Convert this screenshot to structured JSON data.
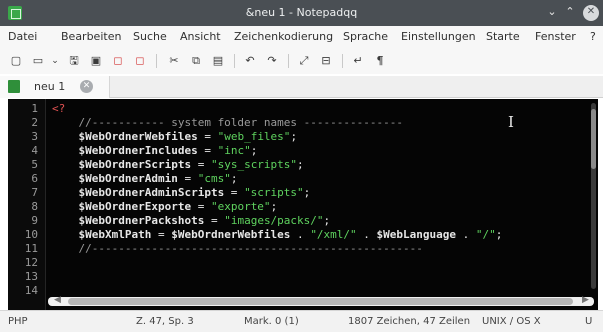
{
  "window": {
    "title": "&neu 1 - Notepadqq",
    "minimize_glyph": "⌄",
    "maximize_glyph": "⌃",
    "close_glyph": "✕"
  },
  "menu": [
    "Datei",
    "Bearbeiten",
    "Suche",
    "Ansicht",
    "Zeichenkodierung",
    "Sprache",
    "Einstellungen",
    "Starte",
    "Fenster",
    "?"
  ],
  "toolbar": {
    "icons": [
      "new-file-icon",
      "open-folder-icon",
      "dropdown-arrow-icon",
      "save-icon",
      "save-all-icon",
      "close-file-icon",
      "close-all-icon",
      "cut-icon",
      "copy-icon",
      "paste-icon",
      "undo-icon",
      "redo-icon",
      "zoom-in-icon",
      "zoom-out-icon",
      "word-wrap-icon",
      "show-all-chars-icon"
    ],
    "glyphs": [
      "▢",
      "▭",
      "⌄",
      "🖫",
      "▣",
      "◻",
      "◻",
      "✂",
      "⧉",
      "▤",
      "↶",
      "↷",
      "⤢",
      "⊟",
      "↵",
      "¶"
    ]
  },
  "tabs": [
    {
      "label": "neu 1",
      "close_glyph": "✕"
    }
  ],
  "editor": {
    "line_numbers": [
      "1",
      "2",
      "3",
      "4",
      "5",
      "6",
      "7",
      "8",
      "9",
      "10",
      "11",
      "12",
      "13",
      "14"
    ],
    "lines": [
      [
        {
          "t": "<?",
          "c": "c-tag"
        }
      ],
      [
        {
          "t": "    //----------- system folder names ---------------",
          "c": "c-comment"
        }
      ],
      [
        {
          "t": "    $WebOrdnerWebfiles",
          "c": "c-var"
        },
        {
          "t": " = ",
          "c": "c-op"
        },
        {
          "t": "\"web_files\"",
          "c": "c-str"
        },
        {
          "t": ";",
          "c": "c-op"
        }
      ],
      [
        {
          "t": "    $WebOrdnerIncludes",
          "c": "c-var"
        },
        {
          "t": " = ",
          "c": "c-op"
        },
        {
          "t": "\"inc\"",
          "c": "c-str"
        },
        {
          "t": ";",
          "c": "c-op"
        }
      ],
      [
        {
          "t": "    $WebOrdnerScripts",
          "c": "c-var"
        },
        {
          "t": " = ",
          "c": "c-op"
        },
        {
          "t": "\"sys_scripts\"",
          "c": "c-str"
        },
        {
          "t": ";",
          "c": "c-op"
        }
      ],
      [
        {
          "t": "    $WebOrdnerAdmin",
          "c": "c-var"
        },
        {
          "t": " = ",
          "c": "c-op"
        },
        {
          "t": "\"cms\"",
          "c": "c-str"
        },
        {
          "t": ";",
          "c": "c-op"
        }
      ],
      [
        {
          "t": "    $WebOrdnerAdminScripts",
          "c": "c-var"
        },
        {
          "t": " = ",
          "c": "c-op"
        },
        {
          "t": "\"scripts\"",
          "c": "c-str"
        },
        {
          "t": ";",
          "c": "c-op"
        }
      ],
      [
        {
          "t": "    $WebOrdnerExporte",
          "c": "c-var"
        },
        {
          "t": " = ",
          "c": "c-op"
        },
        {
          "t": "\"exporte\"",
          "c": "c-str"
        },
        {
          "t": ";",
          "c": "c-op"
        }
      ],
      [
        {
          "t": "    $WebOrdnerPackshots",
          "c": "c-var"
        },
        {
          "t": " = ",
          "c": "c-op"
        },
        {
          "t": "\"images/packs/\"",
          "c": "c-str"
        },
        {
          "t": ";",
          "c": "c-op"
        }
      ],
      [
        {
          "t": "    $WebXmlPath",
          "c": "c-var"
        },
        {
          "t": " = ",
          "c": "c-op"
        },
        {
          "t": "$WebOrdnerWebfiles",
          "c": "c-var"
        },
        {
          "t": " . ",
          "c": "c-op"
        },
        {
          "t": "\"/xml/\"",
          "c": "c-str"
        },
        {
          "t": " . ",
          "c": "c-op"
        },
        {
          "t": "$WebLanguage",
          "c": "c-var"
        },
        {
          "t": " . ",
          "c": "c-op"
        },
        {
          "t": "\"/\"",
          "c": "c-str"
        },
        {
          "t": ";",
          "c": "c-op"
        }
      ],
      [
        {
          "t": "    //--------------------------------------------------",
          "c": "c-comment"
        }
      ],
      [],
      [],
      []
    ],
    "cursor_glyph": "I"
  },
  "status": {
    "language": "PHP",
    "position": "Z. 47, Sp. 3",
    "selection": "Mark. 0 (1)",
    "stats": "1807 Zeichen, 47 Zeilen",
    "eol": "UNIX / OS X",
    "encoding": "U"
  },
  "colors": {
    "titlebar": "#4a4f54",
    "editor_bg": "#050505",
    "string": "#5fd35f",
    "php_tag": "#e05252",
    "comment": "#9a9a9a"
  }
}
